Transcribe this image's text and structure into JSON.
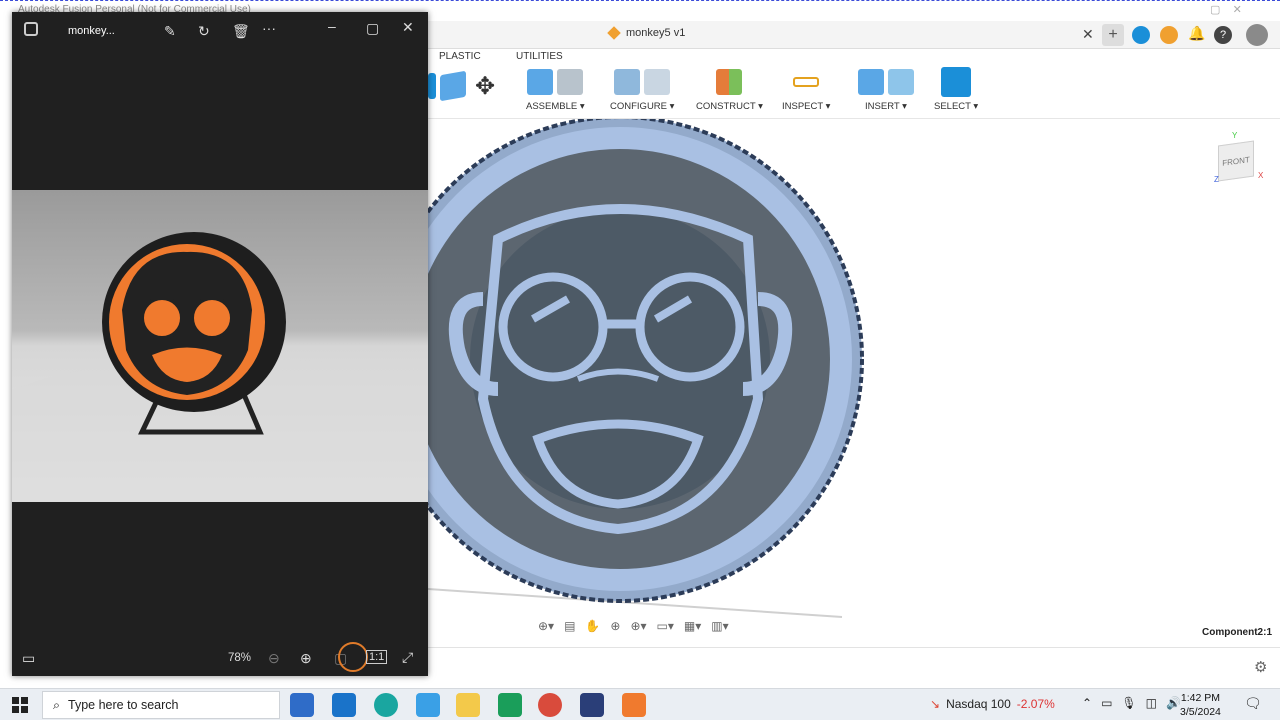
{
  "fusion": {
    "window_title": "Autodesk Fusion Personal (Not for Commercial Use)",
    "doc_title": "monkey5 v1",
    "tabs": [
      "PLASTIC",
      "UTILITIES"
    ],
    "groups": [
      "ASSEMBLE ▾",
      "CONFIGURE ▾",
      "CONSTRUCT ▾",
      "INSPECT ▾",
      "INSERT ▾",
      "SELECT ▾"
    ],
    "viewcube": {
      "face": "FRONT",
      "axis_y": "Y",
      "axis_x": "X",
      "axis_z": "Z"
    },
    "component_label": "Component2:1",
    "colors": {
      "model": "#a9c0e3",
      "inner": "#4d5a66",
      "accent": "#1b8fd8"
    }
  },
  "photos": {
    "title": "monkey...",
    "zoom": "78%",
    "buttons": [
      "edit-icon",
      "rotate-icon",
      "delete-icon",
      "more-icon",
      "minimize-icon",
      "maximize-icon",
      "close-icon"
    ],
    "colors": {
      "disc": "#f07a2e",
      "frame": "#1e1e1e"
    }
  },
  "taskbar": {
    "search_placeholder": "Type here to search",
    "ticker_name": "Nasdaq 100",
    "ticker_change": "-2.07%",
    "time": "1:42 PM",
    "date": "3/5/2024"
  }
}
